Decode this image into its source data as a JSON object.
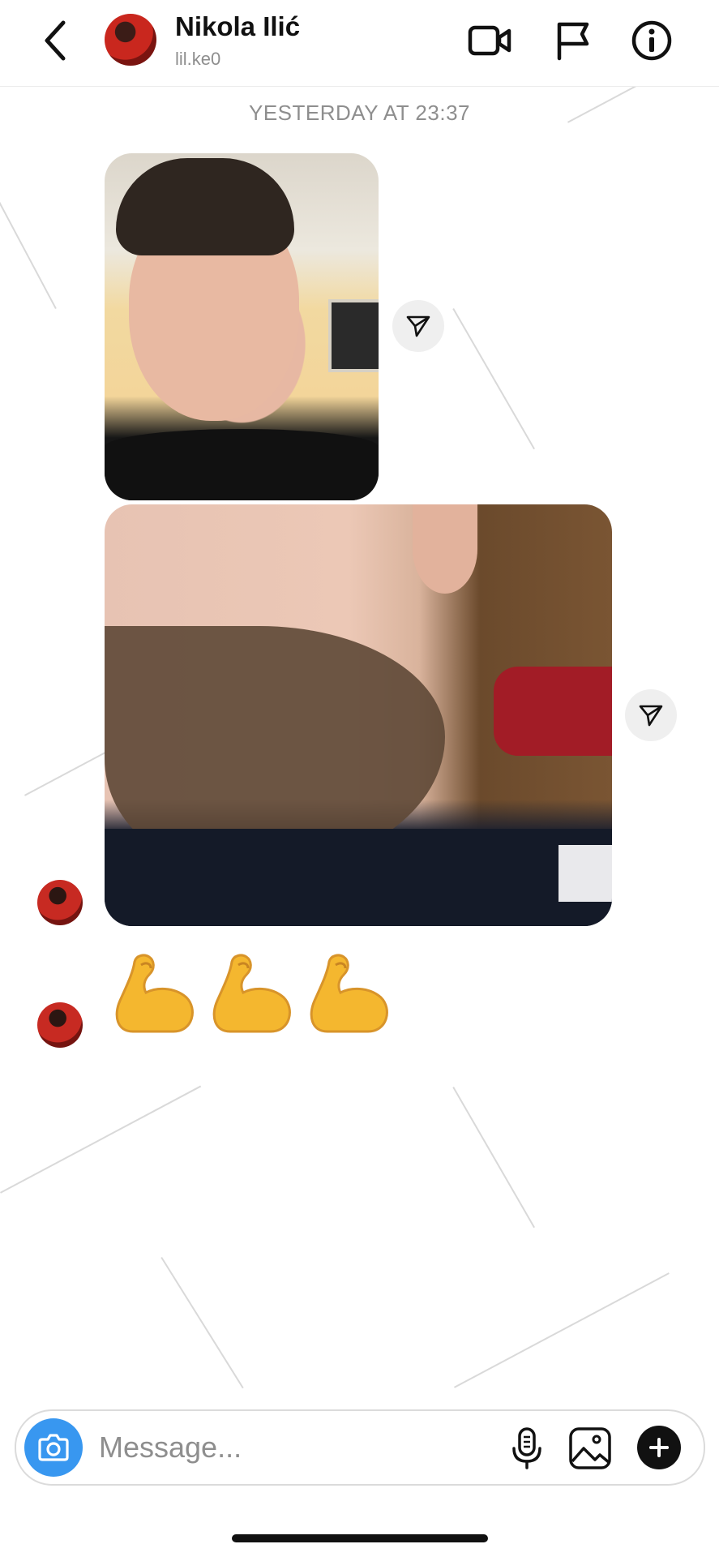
{
  "header": {
    "contact_name": "Nikola Ilić",
    "contact_handle": "lil.ke0",
    "icons": {
      "back": "back-chevron-icon",
      "video": "video-call-icon",
      "flag": "flag-icon",
      "info": "info-icon"
    }
  },
  "conversation": {
    "timestamp": "YESTERDAY AT 23:37",
    "messages": [
      {
        "type": "photo",
        "description_icon": "photo-selfie",
        "share_icon": "share-icon"
      },
      {
        "type": "photo",
        "description_icon": "photo-beard",
        "share_icon": "share-icon"
      },
      {
        "type": "emoji",
        "text": "💪💪💪",
        "emoji_icon": "flexed-biceps-icon"
      }
    ]
  },
  "composer": {
    "placeholder": "Message...",
    "icons": {
      "camera": "camera-icon",
      "mic": "microphone-icon",
      "gallery": "gallery-icon",
      "plus": "plus-icon"
    }
  },
  "colors": {
    "accent_blue": "#3897f0",
    "muted_text": "#8e8e8e",
    "emoji_yellow": "#f4b72f"
  }
}
